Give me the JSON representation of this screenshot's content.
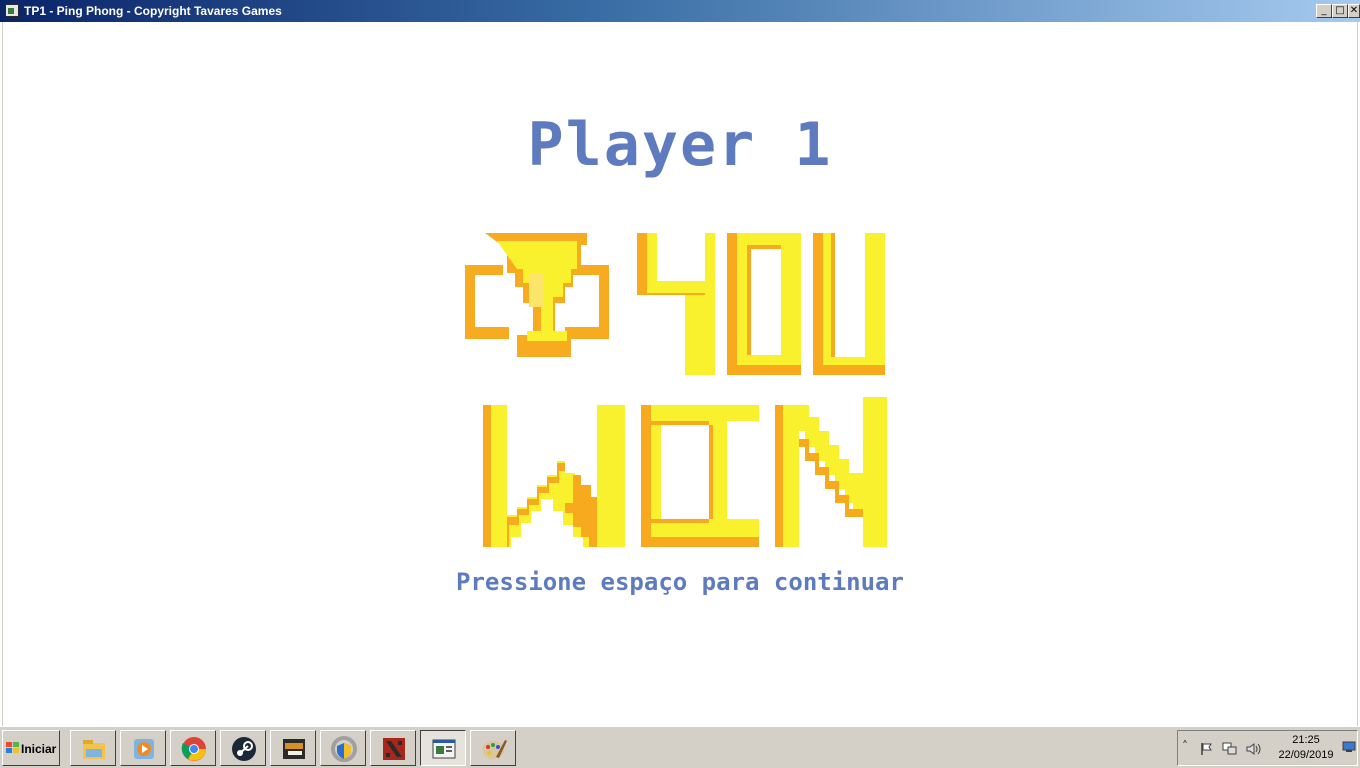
{
  "window": {
    "title": "TP1 - Ping Phong - Copyright Tavares Games",
    "minimize_glyph": "_",
    "maximize_glyph": "□",
    "close_glyph": "✕"
  },
  "game": {
    "player_label": "Player 1",
    "headline_lines": [
      "YOU",
      "WIN"
    ],
    "instruction": "Pressione espaço para continuar",
    "colors": {
      "text_blue": "#5e7bbf",
      "gold_light": "#f9f12e",
      "gold_dark": "#f8aa1e",
      "trophy_gold": "#f7ab20"
    }
  },
  "taskbar": {
    "start_label": "Iniciar",
    "items": [
      {
        "name": "file-explorer-icon"
      },
      {
        "name": "media-player-icon"
      },
      {
        "name": "chrome-icon"
      },
      {
        "name": "steam-icon"
      },
      {
        "name": "game-icon"
      },
      {
        "name": "security-shield-icon"
      },
      {
        "name": "dota-icon"
      },
      {
        "name": "ping-phong-window-icon"
      },
      {
        "name": "paint-icon"
      }
    ],
    "tray": {
      "time": "21:25",
      "date": "22/09/2019"
    }
  }
}
